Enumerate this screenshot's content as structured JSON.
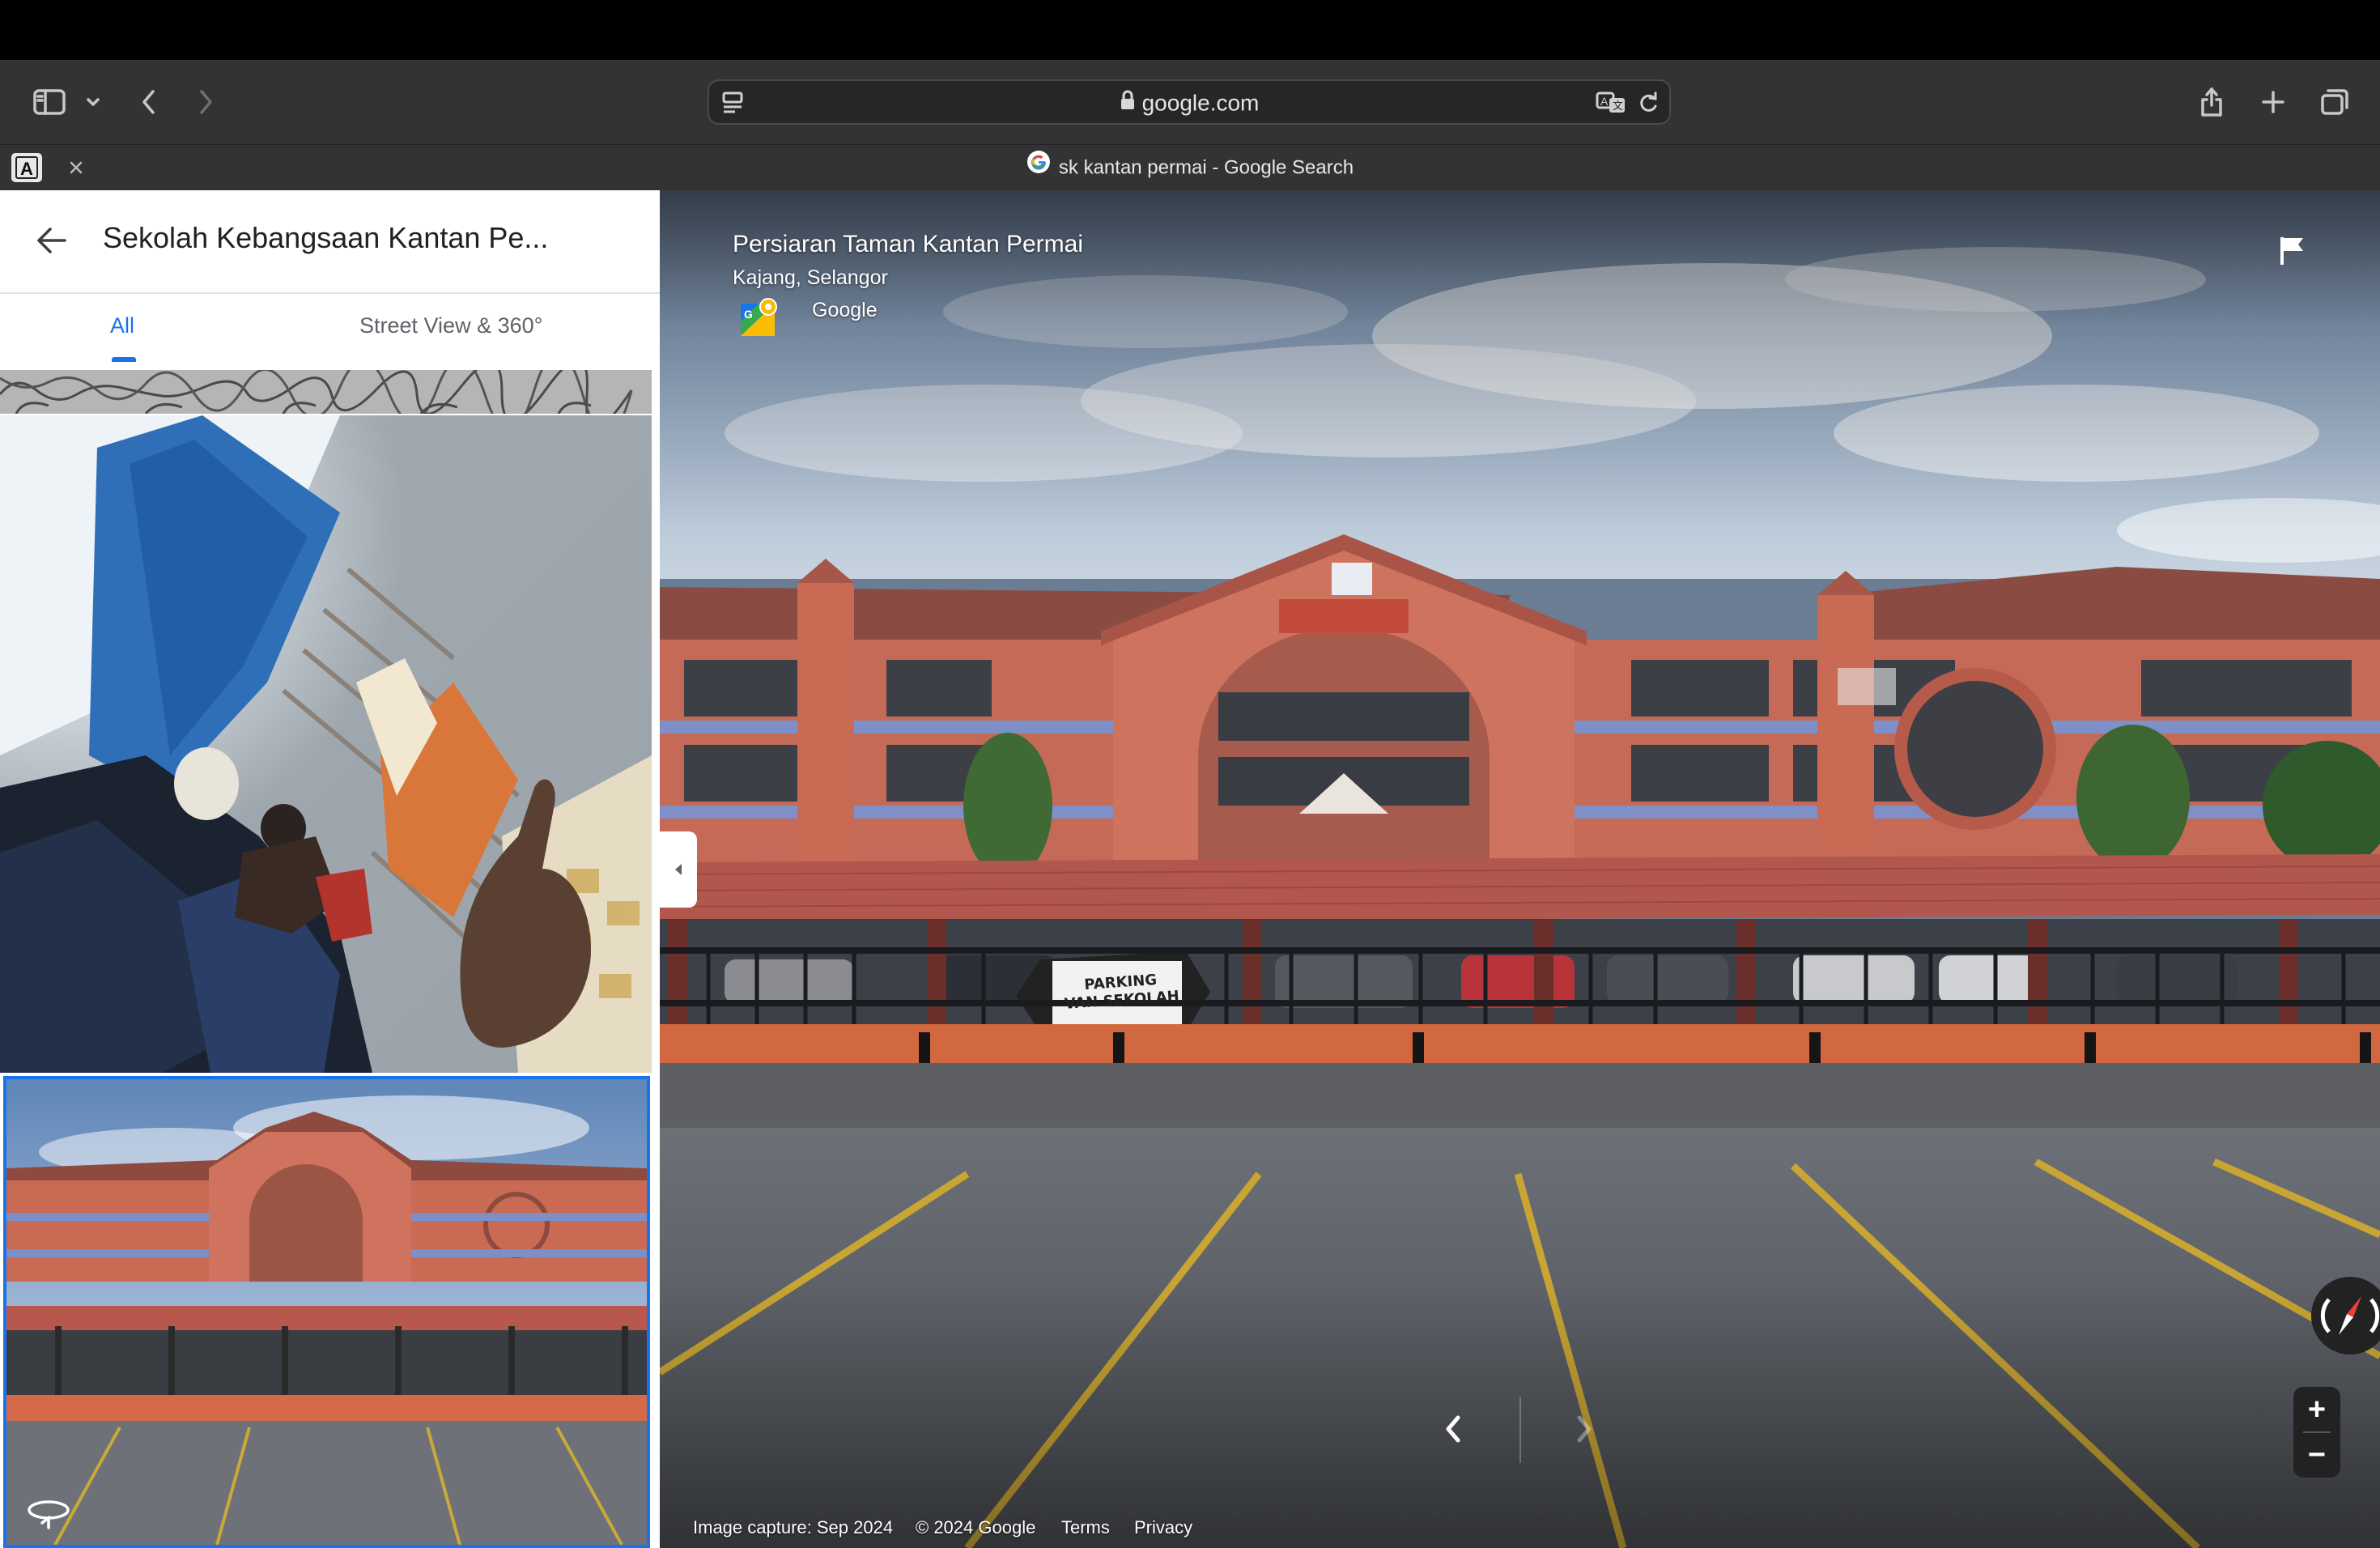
{
  "browser": {
    "address_url": "google.com",
    "tab_title": "sk kantan permai - Google Search"
  },
  "panel": {
    "title": "Sekolah Kebangsaan Kantan Pe...",
    "tabs": [
      {
        "label": "All",
        "selected": true
      },
      {
        "label": "Street View & 360°",
        "selected": false
      }
    ]
  },
  "streetview": {
    "street_name": "Persiaran Taman Kantan Permai",
    "locality": "Kajang, Selangor",
    "provider": "Google",
    "parking_sign": [
      "PARKING",
      "VAN SEKOLAH"
    ],
    "footer": {
      "capture": "Image capture: Sep 2024",
      "copyright": "© 2024 Google",
      "terms": "Terms",
      "privacy": "Privacy"
    },
    "zoom_in": "+",
    "zoom_out": "−"
  },
  "colors": {
    "toolbar": "#333334",
    "accent": "#1a73e8",
    "building": "#c96a55",
    "roof": "#b55045"
  }
}
